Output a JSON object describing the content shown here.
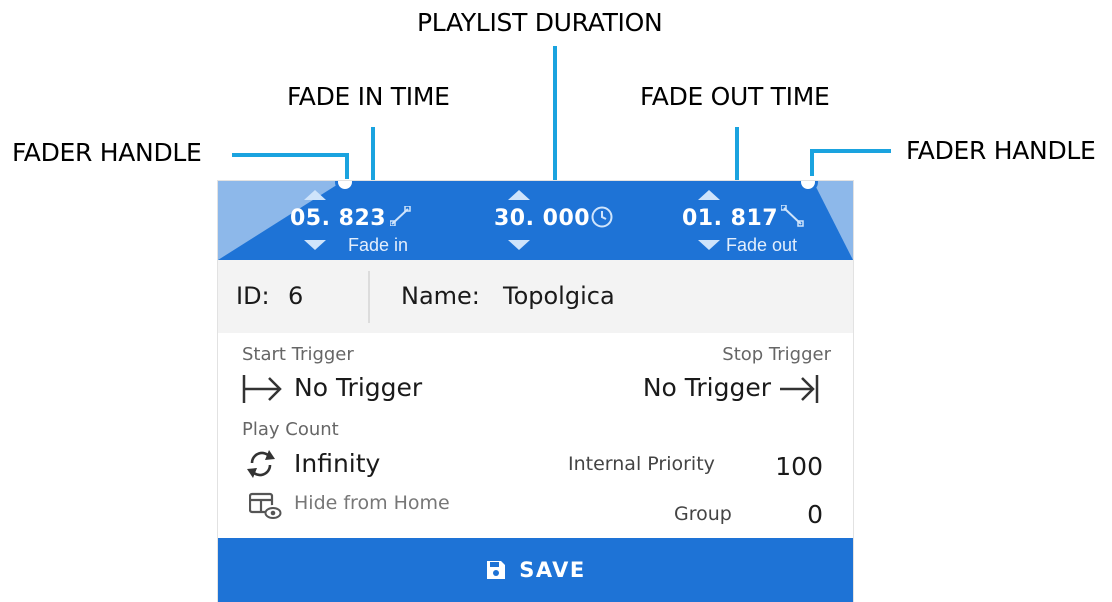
{
  "callouts": {
    "playlist_duration": "PLAYLIST DURATION",
    "fade_in_time": "FADE IN TIME",
    "fade_out_time": "FADE OUT TIME",
    "fader_handle_left": "FADER HANDLE",
    "fader_handle_right": "FADER HANDLE"
  },
  "header": {
    "fade_in": {
      "value": "05. 823",
      "label": "Fade in",
      "icon": "fade-in-icon"
    },
    "duration": {
      "value": "30. 000",
      "icon": "clock-icon"
    },
    "fade_out": {
      "value": "01. 817",
      "label": "Fade out",
      "icon": "fade-out-icon"
    }
  },
  "info": {
    "id_label": "ID:",
    "id_value": "6",
    "name_label": "Name:",
    "name_value": "Topolgica"
  },
  "triggers": {
    "start_label": "Start Trigger",
    "start_value": "No Trigger",
    "stop_label": "Stop Trigger",
    "stop_value": "No Trigger"
  },
  "play": {
    "count_label": "Play Count",
    "count_value": "Infinity",
    "hide_label": "Hide from Home"
  },
  "priority": {
    "internal_label": "Internal Priority",
    "internal_value": "100",
    "group_label": "Group",
    "group_value": "0"
  },
  "save_label": "SAVE",
  "colors": {
    "accent": "#1e73d6",
    "callout_line": "#1aa3df",
    "header_corner": "#8db8ea"
  }
}
